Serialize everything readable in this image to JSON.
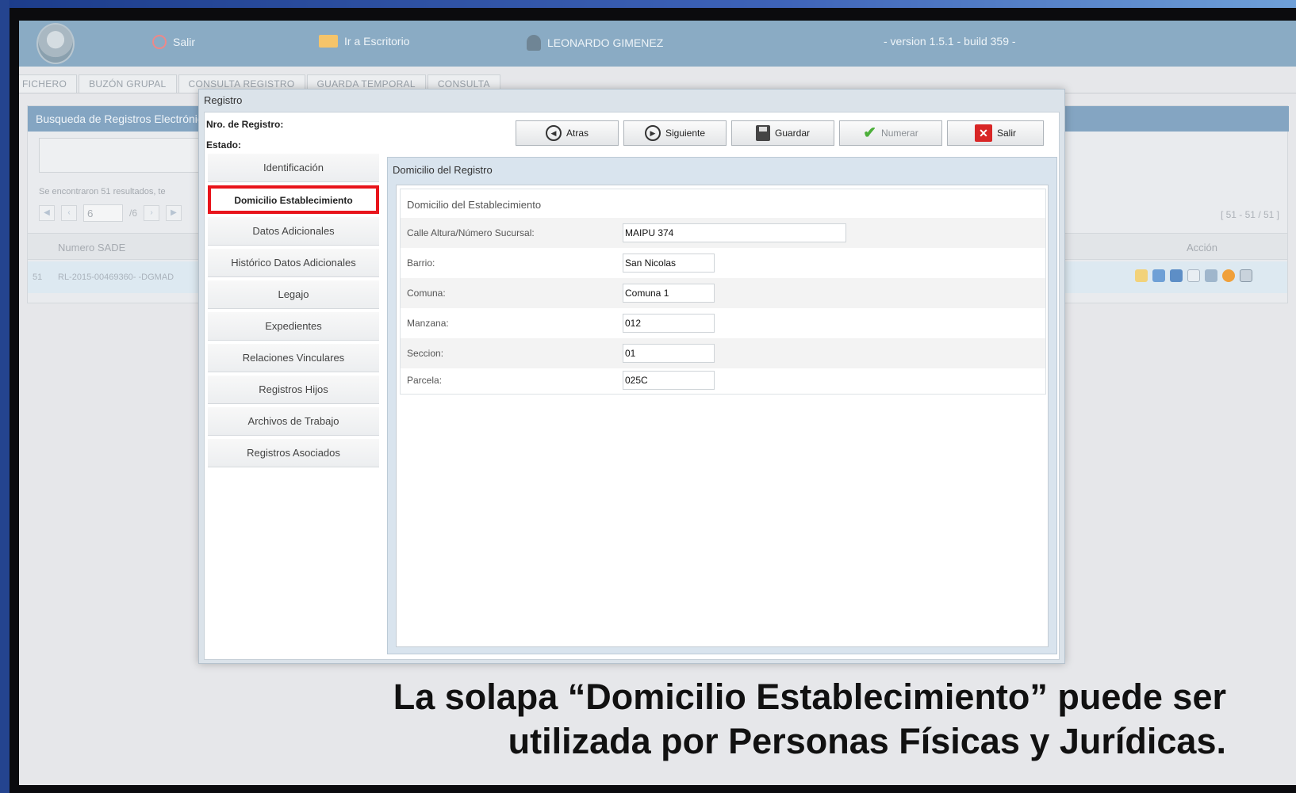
{
  "header": {
    "salir_label": "Salir",
    "escritorio_label": "Ir a Escritorio",
    "user_name": "LEONARDO GIMENEZ",
    "version": "- version 1.5.1 - build 359 -"
  },
  "tabs": [
    "FICHERO",
    "BUZÓN GRUPAL",
    "CONSULTA REGISTRO",
    "GUARDA TEMPORAL",
    "CONSULTA"
  ],
  "background": {
    "panel_title": "Busqueda de Registros Electrónic",
    "results_text": "Se encontraron 51 resultados, te",
    "page_value": "6",
    "page_total": "/6",
    "range": "[ 51 - 51 / 51 ]",
    "col_numero": "Numero SADE",
    "col_accion": "Acción",
    "row_index": "51",
    "row_numero": "RL-2015-00469360- -DGMAD"
  },
  "modal": {
    "title": "Registro",
    "nro_registro_label": "Nro. de Registro:",
    "estado_label": "Estado:",
    "toolbar": {
      "atras": "Atras",
      "siguiente": "Siguiente",
      "guardar": "Guardar",
      "numerar": "Numerar",
      "salir": "Salir"
    },
    "menu": [
      "Identificación",
      "Domicilio Establecimiento",
      "Datos Adicionales",
      "Histórico Datos Adicionales",
      "Legajo",
      "Expedientes",
      "Relaciones Vinculares",
      "Registros Hijos",
      "Archivos de Trabajo",
      "Registros Asociados"
    ],
    "content_title": "Domicilio del Registro",
    "form_legend": "Domicilio del Establecimiento",
    "fields": [
      {
        "label": "Calle Altura/Número Sucursal:",
        "value": "MAIPU 374"
      },
      {
        "label": "Barrio:",
        "value": "San Nicolas"
      },
      {
        "label": "Comuna:",
        "value": "Comuna 1"
      },
      {
        "label": "Manzana:",
        "value": "012"
      },
      {
        "label": "Seccion:",
        "value": "01"
      },
      {
        "label": "Parcela:",
        "value": "025C"
      }
    ]
  },
  "caption": {
    "line1": "La solapa “Domicilio Establecimiento” puede ser",
    "line2": "utilizada por Personas Físicas y Jurídicas."
  },
  "colors": {
    "header_bg": "#8aabc4",
    "highlight_border": "#e8141b",
    "panel_title_bg": "#84a5c2"
  }
}
